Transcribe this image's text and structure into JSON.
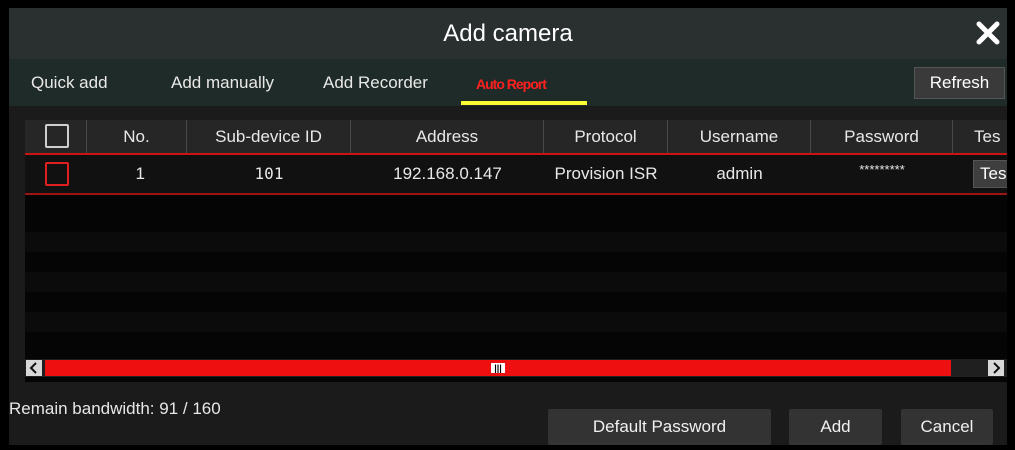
{
  "dialog": {
    "title": "Add camera",
    "close_icon": "close-icon"
  },
  "tabs": [
    {
      "label": "Quick add",
      "active": false
    },
    {
      "label": "Add manually",
      "active": false
    },
    {
      "label": "Add Recorder",
      "active": false
    },
    {
      "label": "Auto Report",
      "active": true
    }
  ],
  "toolbar": {
    "refresh_label": "Refresh"
  },
  "table": {
    "columns": [
      "No.",
      "Sub-device ID",
      "Address",
      "Protocol",
      "Username",
      "Password",
      "Tes"
    ],
    "rows": [
      {
        "no": "1",
        "sub_device_id": "101",
        "address": "192.168.0.147",
        "protocol": "Provision ISR",
        "username": "admin",
        "password": "*********",
        "test_label": "Tes"
      }
    ]
  },
  "scrollbar": {
    "left_icon": "chevron-left-icon",
    "right_icon": "chevron-right-icon",
    "grip": "|||"
  },
  "status": {
    "bandwidth": "Remain bandwidth: 91 / 160"
  },
  "buttons": {
    "default_password": "Default Password",
    "add": "Add",
    "cancel": "Cancel"
  },
  "colors": {
    "accent_red": "#e02020",
    "tab_underline": "#ffff33",
    "scroll_thumb": "#ee1010"
  }
}
